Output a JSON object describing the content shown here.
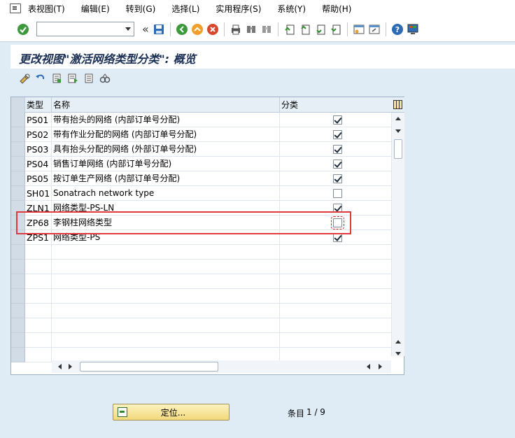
{
  "menu": {
    "items": [
      {
        "label": "表视图(T)"
      },
      {
        "label": "编辑(E)"
      },
      {
        "label": "转到(G)"
      },
      {
        "label": "选择(L)"
      },
      {
        "label": "实用程序(S)"
      },
      {
        "label": "系统(Y)"
      },
      {
        "label": "帮助(H)"
      }
    ]
  },
  "toolbar": {
    "command_value": "",
    "icons": [
      "enter-icon",
      "command-field",
      "back-arrows-icon",
      "save-icon",
      "back-icon",
      "exit-icon",
      "cancel-icon",
      "print-icon",
      "find-icon",
      "find-next-icon",
      "first-page-icon",
      "previous-page-icon",
      "next-page-icon",
      "last-page-icon",
      "new-session-icon",
      "shortcut-icon",
      "help-icon",
      "layout-icon"
    ]
  },
  "page": {
    "title": "更改视图\"激活网络类型分类\": 概览"
  },
  "table": {
    "columns": [
      "类型",
      "名称",
      "分类"
    ],
    "rows": [
      {
        "type": "PS01",
        "name": "带有抬头的网络 (内部订单号分配)",
        "classified": true
      },
      {
        "type": "PS02",
        "name": "带有作业分配的网络 (内部订单号分配)",
        "classified": true
      },
      {
        "type": "PS03",
        "name": "具有抬头分配的网络 (外部订单号分配)",
        "classified": true
      },
      {
        "type": "PS04",
        "name": "销售订单网络 (内部订单号分配)",
        "classified": true
      },
      {
        "type": "PS05",
        "name": "按订单生产网络 (内部订单号分配)",
        "classified": true
      },
      {
        "type": "SH01",
        "name": "Sonatrach network type",
        "classified": false
      },
      {
        "type": "ZLN1",
        "name": "网络类型-PS-LN",
        "classified": true
      },
      {
        "type": "ZP68",
        "name": "李钢柱网络类型",
        "classified": false
      },
      {
        "type": "ZPS1",
        "name": "网络类型-PS",
        "classified": true
      },
      {
        "type": "",
        "name": "",
        "classified": null
      },
      {
        "type": "",
        "name": "",
        "classified": null
      },
      {
        "type": "",
        "name": "",
        "classified": null
      },
      {
        "type": "",
        "name": "",
        "classified": null
      },
      {
        "type": "",
        "name": "",
        "classified": null
      },
      {
        "type": "",
        "name": "",
        "classified": null
      },
      {
        "type": "",
        "name": "",
        "classified": null
      },
      {
        "type": "",
        "name": "",
        "classified": null
      }
    ]
  },
  "footer": {
    "position_button": "定位...",
    "entry_label": "条目",
    "entry_count": "1 / 9"
  },
  "colors": {
    "background": "#dfebf5",
    "highlight": "#e03a3a",
    "button": "#f3d97b"
  }
}
